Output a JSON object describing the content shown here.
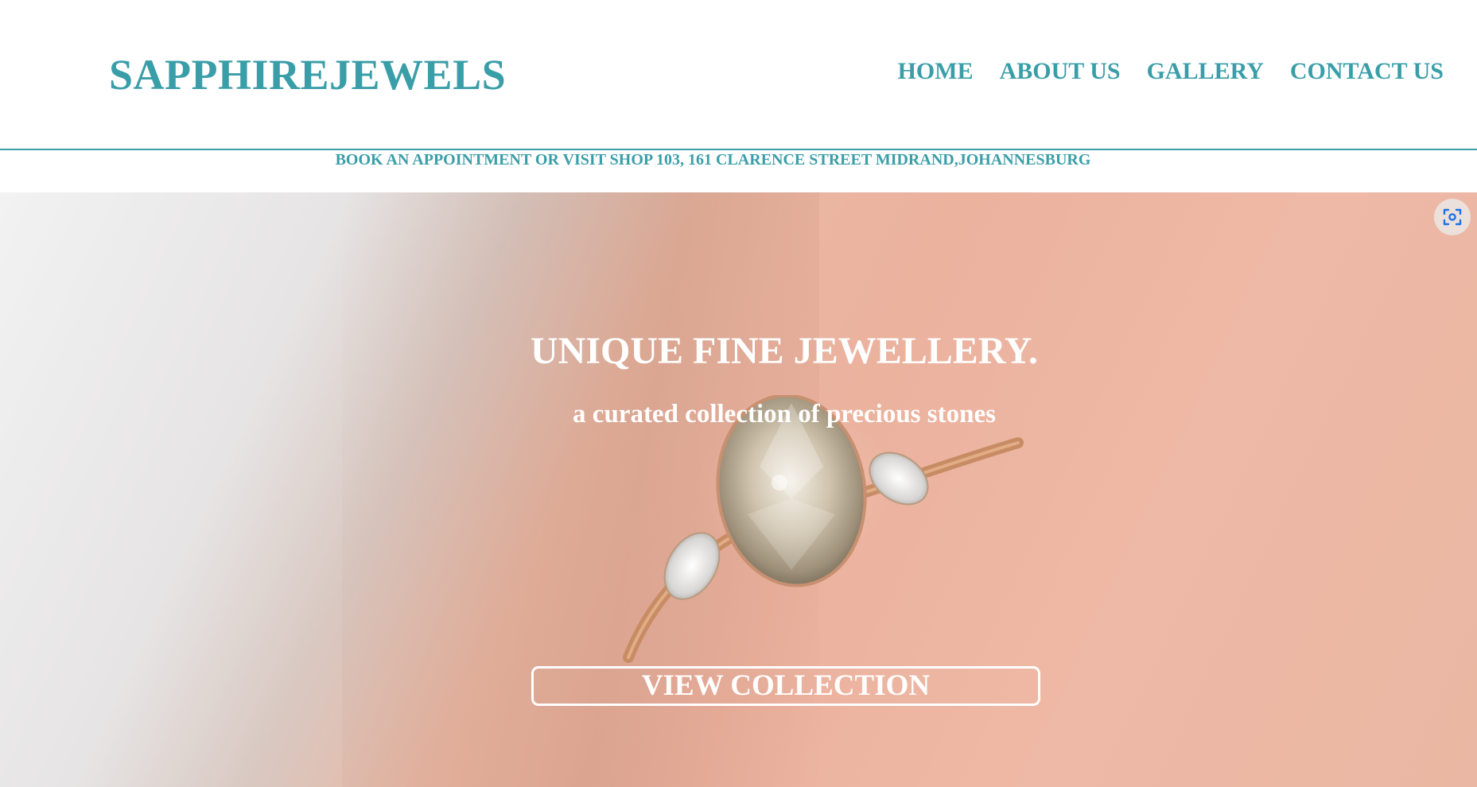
{
  "header": {
    "logo": "SAPPHIREJEWELS",
    "nav": [
      {
        "label": "HOME"
      },
      {
        "label": "ABOUT US"
      },
      {
        "label": "GALLERY"
      },
      {
        "label": "CONTACT US"
      }
    ]
  },
  "announcement": {
    "text": "BOOK AN APPOINTMENT OR VISIT SHOP 103, 161 CLARENCE STREET MIDRAND,JOHANNESBURG"
  },
  "hero": {
    "title": "UNIQUE FINE JEWELLERY.",
    "subtitle": "a curated collection of precious stones",
    "cta_label": "VIEW COLLECTION"
  },
  "icons": {
    "lens": "visual-search-icon"
  },
  "colors": {
    "brand": "#3a9ea8",
    "hero_text": "#ffffff",
    "lens_icon": "#1a73e8"
  }
}
